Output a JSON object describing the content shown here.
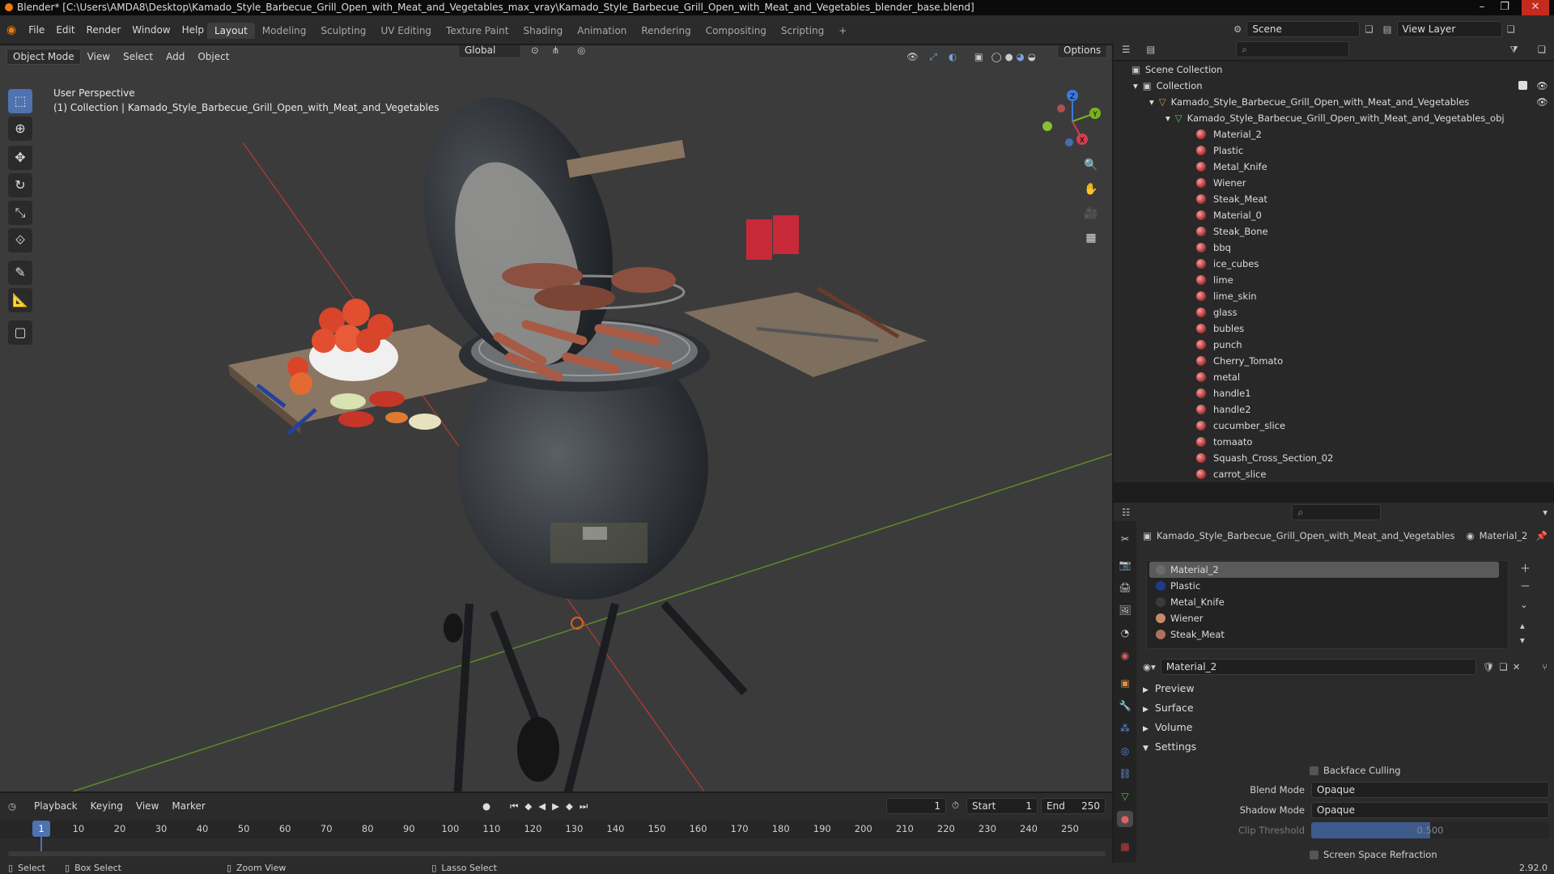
{
  "window": {
    "title": "Blender* [C:\\Users\\AMDA8\\Desktop\\Kamado_Style_Barbecue_Grill_Open_with_Meat_and_Vegetables_max_vray\\Kamado_Style_Barbecue_Grill_Open_with_Meat_and_Vegetables_blender_base.blend]",
    "minimize": "–",
    "maximize": "❐",
    "close": "✕"
  },
  "menu": [
    "File",
    "Edit",
    "Render",
    "Window",
    "Help"
  ],
  "workspaces": [
    "Layout",
    "Modeling",
    "Sculpting",
    "UV Editing",
    "Texture Paint",
    "Shading",
    "Animation",
    "Rendering",
    "Compositing",
    "Scripting",
    "+"
  ],
  "scene": {
    "name": "Scene",
    "view_layer": "View Layer"
  },
  "viewport": {
    "mode": "Object Mode",
    "menus": [
      "View",
      "Select",
      "Add",
      "Object"
    ],
    "transform": "Global",
    "options": "Options",
    "overlay_line1": "User Perspective",
    "overlay_line2": "(1) Collection | Kamado_Style_Barbecue_Grill_Open_with_Meat_and_Vegetables",
    "gizmo": {
      "x": "X",
      "y": "Y",
      "z": "Z"
    }
  },
  "timeline": {
    "menus": [
      "Playback",
      "Keying",
      "View",
      "Marker"
    ],
    "current_frame": "1",
    "start_label": "Start",
    "start": "1",
    "end_label": "End",
    "end": "250",
    "ticks": [
      "1",
      "10",
      "20",
      "30",
      "40",
      "50",
      "60",
      "70",
      "80",
      "90",
      "100",
      "110",
      "120",
      "130",
      "140",
      "150",
      "160",
      "170",
      "180",
      "190",
      "200",
      "210",
      "220",
      "230",
      "240",
      "250"
    ]
  },
  "outliner": {
    "scene_collection": "Scene Collection",
    "collection": "Collection",
    "object": "Kamado_Style_Barbecue_Grill_Open_with_Meat_and_Vegetables",
    "mesh": "Kamado_Style_Barbecue_Grill_Open_with_Meat_and_Vegetables_obj",
    "materials": [
      "Material_2",
      "Plastic",
      "Metal_Knife",
      "Wiener",
      "Steak_Meat",
      "Material_0",
      "Steak_Bone",
      "bbq",
      "ice_cubes",
      "lime",
      "lime_skin",
      "glass",
      "bubles",
      "punch",
      "Cherry_Tomato",
      "metal",
      "handle1",
      "handle2",
      "cucumber_slice",
      "tomaato",
      "Squash_Cross_Section_02",
      "carrot_slice"
    ]
  },
  "properties": {
    "breadcrumb_object": "Kamado_Style_Barbecue_Grill_Open_with_Meat_and_Vegetables",
    "breadcrumb_material": "Material_2",
    "slots": [
      {
        "name": "Material_2",
        "color": "#6b6b6b"
      },
      {
        "name": "Plastic",
        "color": "#1f3a8a"
      },
      {
        "name": "Metal_Knife",
        "color": "#3a3a3a"
      },
      {
        "name": "Wiener",
        "color": "#c48a6a"
      },
      {
        "name": "Steak_Meat",
        "color": "#b07060"
      }
    ],
    "material_name": "Material_2",
    "panels": [
      "Preview",
      "Surface",
      "Volume",
      "Settings"
    ],
    "backface_culling": "Backface Culling",
    "blend_mode_label": "Blend Mode",
    "blend_mode": "Opaque",
    "shadow_mode_label": "Shadow Mode",
    "shadow_mode": "Opaque",
    "clip_threshold_label": "Clip Threshold",
    "clip_threshold": "0.500",
    "ssr": "Screen Space Refraction"
  },
  "status": {
    "select": "Select",
    "box_select": "Box Select",
    "zoom_view": "Zoom View",
    "lasso_select": "Lasso Select",
    "version": "2.92.0"
  }
}
